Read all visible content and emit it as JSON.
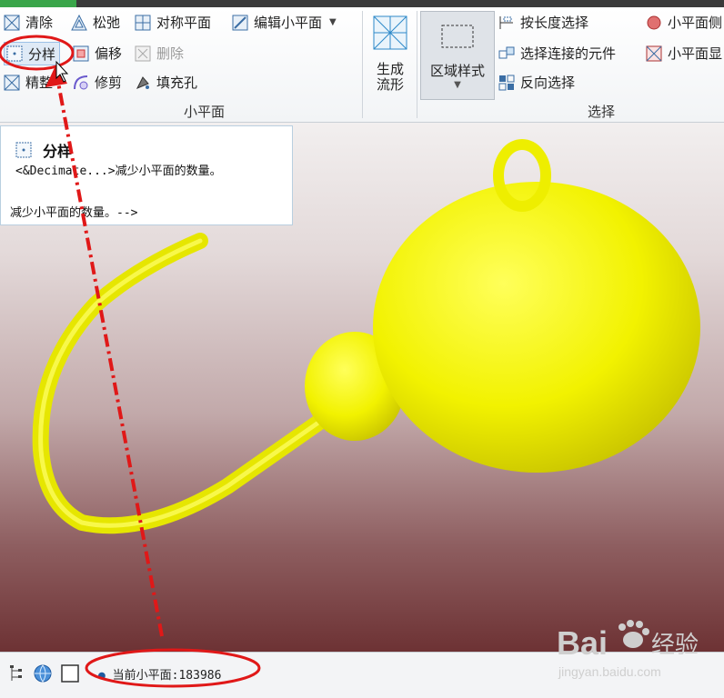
{
  "ribbon": {
    "facet_group": {
      "label": "小平面",
      "buttons": {
        "clean": "清除",
        "relax": "松弛",
        "symmetry": "对称平面",
        "edit_facet": "编辑小平面",
        "decimate": "分样",
        "offset": "偏移",
        "delete": "删除",
        "refine": "精整",
        "trim": "修剪",
        "fill_hole": "填充孔"
      }
    },
    "generate": {
      "line1": "生成",
      "line2": "流形"
    },
    "region_style": {
      "label": "区域样式"
    },
    "select_group": {
      "label": "选择",
      "buttons": {
        "select_by_length": "按长度选择",
        "select_connected": "选择连接的元件",
        "reverse_select": "反向选择",
        "facet_side": "小平面侧",
        "facet_display": "小平面显"
      }
    }
  },
  "tooltip": {
    "title": "分样",
    "line1": "<&Decimate...>减少小平面的数量。",
    "line2": "减少小平面的数量。-->"
  },
  "statusbar": {
    "label": "当前小平面:",
    "value": "183986"
  },
  "watermark": {
    "brand": "Bai",
    "cn": "经验",
    "url": "jingyan.baidu.com"
  },
  "colors": {
    "model_yellow": "#f2f200",
    "annotation_red": "#e01818",
    "accent_green": "#3aa64a"
  }
}
